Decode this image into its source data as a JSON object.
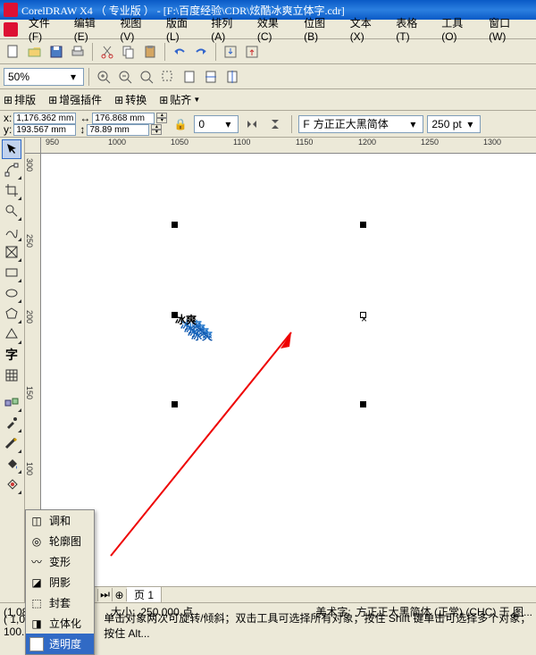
{
  "title": "CorelDRAW X4 （ 专业版 ） - [F:\\百度经验\\CDR\\炫酷冰爽立体字.cdr]",
  "menus": {
    "file": "文件(F)",
    "edit": "编辑(E)",
    "view": "视图(V)",
    "layout": "版面(L)",
    "arrange": "排列(A)",
    "effects": "效果(C)",
    "bitmap": "位图(B)",
    "text": "文本(X)",
    "table": "表格(T)",
    "tools": "工具(O)",
    "window": "窗口(W)"
  },
  "toolbar2": {
    "zoom": "50%",
    "tabs": {
      "layout": "排版",
      "enhance": "增强插件",
      "convert": "转换",
      "paste": "贴齐"
    }
  },
  "props": {
    "x": "1,176.362 mm",
    "y": "193.567 mm",
    "w": "176.868 mm",
    "h": "78.89 mm",
    "rotate": "0",
    "font": "方正正大黑简体",
    "size": "250 pt"
  },
  "ruler_h": [
    "950",
    "1000",
    "1050",
    "1100",
    "1150",
    "1200",
    "1250",
    "1300"
  ],
  "ruler_v": [
    "300",
    "250",
    "200",
    "150",
    "100"
  ],
  "flyout": {
    "items": [
      "调和",
      "轮廓图",
      "变形",
      "阴影",
      "封套",
      "立体化",
      "透明度"
    ],
    "hover_index": 6
  },
  "page": {
    "count": "1",
    "label": "页 1"
  },
  "canvas_text": "冰爽",
  "status": {
    "coord": "(1,086",
    "size_label": "大小:",
    "size_value": "250.000 点",
    "art_label": "美术字:",
    "art_value": "方正正大黑简体 (正常) (CHC) 于 图...",
    "coord2": "( 1,001.177, 100.114 )",
    "hint": "单击对象两次可旋转/倾斜；双击工具可选择所有对象；按住 Shift 键单击可选择多个对象；按住 Alt..."
  }
}
